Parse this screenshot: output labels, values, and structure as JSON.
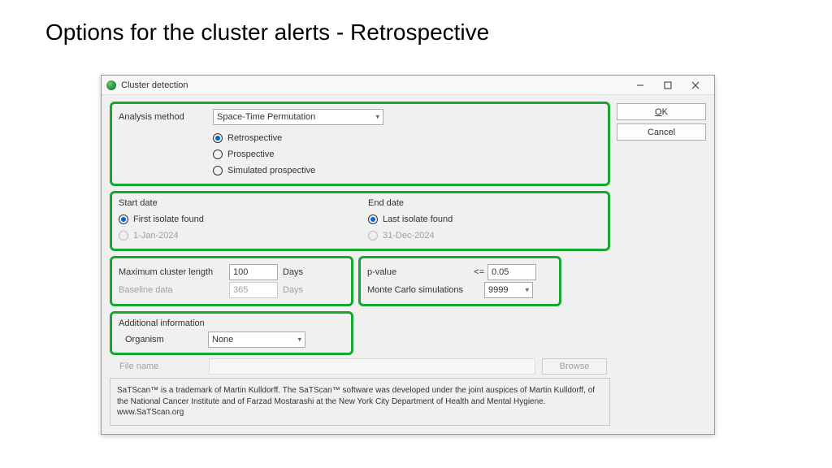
{
  "slide": {
    "title": "Options for the cluster alerts - Retrospective"
  },
  "window": {
    "title": "Cluster detection",
    "buttons": {
      "ok": "OK",
      "cancel": "Cancel"
    }
  },
  "analysis": {
    "label": "Analysis method",
    "method": "Space-Time Permutation",
    "options": {
      "retrospective": "Retrospective",
      "prospective": "Prospective",
      "simulated": "Simulated prospective"
    },
    "selected": "retrospective"
  },
  "dates": {
    "start": {
      "label": "Start date",
      "opt_found": "First isolate found",
      "opt_date_value": "1-Jan-2024"
    },
    "end": {
      "label": "End date",
      "opt_found": "Last isolate found",
      "opt_date_value": "31-Dec-2024"
    }
  },
  "cluster": {
    "max_label": "Maximum cluster length",
    "max_value": "100",
    "max_unit": "Days",
    "baseline_label": "Baseline data",
    "baseline_value": "365",
    "baseline_unit": "Days"
  },
  "stats": {
    "pvalue_label": "p-value",
    "pvalue_op": "<=",
    "pvalue_value": "0.05",
    "mc_label": "Monte Carlo simulations",
    "mc_value": "9999"
  },
  "additional": {
    "heading": "Additional information",
    "organism_label": "Organism",
    "organism_value": "None",
    "filename_label": "File name",
    "filename_value": "",
    "browse": "Browse"
  },
  "footer": "SaTScan™ is a trademark of Martin Kulldorff. The SaTScan™ software was developed under the joint auspices of Martin Kulldorff, of the National Cancer Institute and of Farzad Mostarashi at the New York City Department of Health and Mental Hygiene. www.SaTScan.org"
}
